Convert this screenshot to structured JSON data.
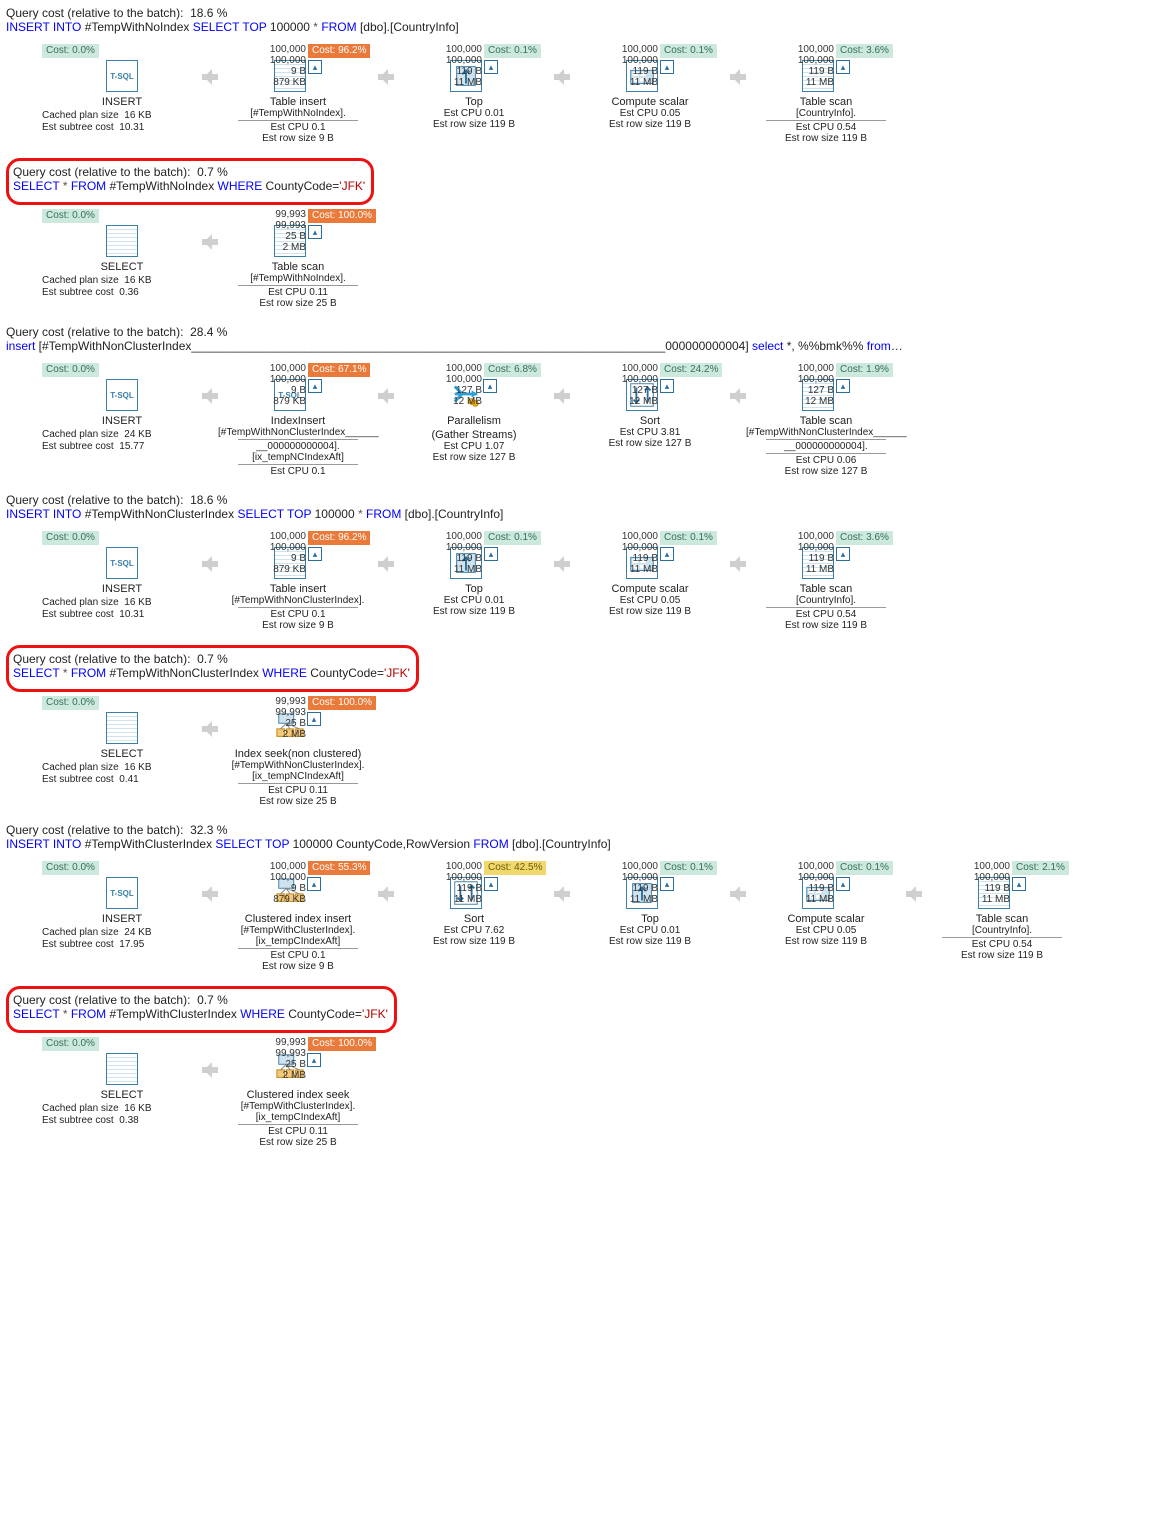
{
  "labels": {
    "query_cost_prefix": "Query cost (relative to the batch):",
    "cached_plan": "Cached plan size",
    "est_subtree": "Est subtree cost",
    "est_cpu": "Est CPU",
    "est_row_size": "Est row size"
  },
  "icons": [
    "tsql",
    "table-insert",
    "top",
    "compute-scalar",
    "table-scan",
    "select",
    "parallelism",
    "sort",
    "index-insert",
    "index-seek",
    "clustered-index-insert",
    "clustered-index-seek"
  ],
  "sections": [
    {
      "id": "q1",
      "highlight": false,
      "cost_pct": "18.6 %",
      "sql": [
        [
          "kw",
          "INSERT INTO"
        ],
        [
          "",
          " #TempWithNoIndex "
        ],
        [
          "kw",
          "SELECT TOP"
        ],
        [
          "",
          " 100000 "
        ],
        [
          "star",
          "*"
        ],
        [
          "",
          " "
        ],
        [
          "kw",
          "FROM"
        ],
        [
          "",
          " [dbo].[CountryInfo]"
        ]
      ],
      "root_metrics": {
        "cached_plan": "16 KB",
        "est_subtree": "10.31"
      },
      "nodes": [
        {
          "cost_left": "Cost: 0.0%",
          "icon": "tsql",
          "label": "INSERT"
        },
        {
          "stats": [
            "100,000",
            "100,000",
            "9 B",
            "879 KB"
          ],
          "cost_right": "Cost: 96.2%",
          "cost_class": "co",
          "icon": "table-insert",
          "label": "Table insert",
          "sub": [
            "[#TempWithNoIndex].",
            "—",
            "Est CPU  0.1",
            "Est row size  9 B"
          ]
        },
        {
          "stats": [
            "100,000",
            "100,000",
            "119 B",
            "11 MB"
          ],
          "cost_right": "Cost: 0.1%",
          "cost_class": "cg",
          "icon": "top",
          "label": "Top",
          "sub": [
            "Est CPU  0.01",
            "Est row size  119 B"
          ]
        },
        {
          "stats": [
            "100,000",
            "100,000",
            "119 B",
            "11 MB"
          ],
          "cost_right": "Cost: 0.1%",
          "cost_class": "cg",
          "icon": "compute",
          "label": "Compute scalar",
          "sub": [
            "Est CPU  0.05",
            "Est row size  119 B"
          ]
        },
        {
          "stats": [
            "100,000",
            "100,000",
            "119 B",
            "11 MB"
          ],
          "cost_right": "Cost: 3.6%",
          "cost_class": "cg",
          "icon": "table-scan",
          "label": "Table scan",
          "sub": [
            "[CountryInfo].",
            "—",
            "Est CPU  0.54",
            "Est row size  119 B"
          ]
        }
      ]
    },
    {
      "id": "q2",
      "highlight": true,
      "cost_pct": "0.7 %",
      "sql": [
        [
          "kw",
          "SELECT"
        ],
        [
          "",
          " "
        ],
        [
          "star",
          "*"
        ],
        [
          "",
          " "
        ],
        [
          "kw",
          "FROM"
        ],
        [
          "",
          " #TempWithNoIndex "
        ],
        [
          "kw",
          "WHERE"
        ],
        [
          "",
          " CountyCode="
        ],
        [
          "lit",
          "'JFK'"
        ]
      ],
      "root_metrics": {
        "cached_plan": "16 KB",
        "est_subtree": "0.36"
      },
      "nodes": [
        {
          "cost_left": "Cost: 0.0%",
          "icon": "select",
          "label": "SELECT"
        },
        {
          "stats": [
            "99,993",
            "99,993",
            "25 B",
            "2 MB"
          ],
          "cost_right": "Cost: 100.0%",
          "cost_class": "co",
          "icon": "table-scan",
          "label": "Table scan",
          "sub": [
            "[#TempWithNoIndex].",
            "—",
            "Est CPU  0.11",
            "Est row size  25 B"
          ]
        }
      ]
    },
    {
      "id": "q3",
      "highlight": false,
      "cost_pct": "28.4 %",
      "sql": [
        [
          "kw",
          "insert"
        ],
        [
          "",
          " [#TempWithNonClusterIndex_______________________________________________________________________000000000004] "
        ],
        [
          "kw",
          "select"
        ],
        [
          "",
          " *, %%bmk%% "
        ],
        [
          "kw",
          "from"
        ],
        [
          "",
          "…"
        ]
      ],
      "root_metrics": {
        "cached_plan": "24 KB",
        "est_subtree": "15.77"
      },
      "nodes": [
        {
          "cost_left": "Cost: 0.0%",
          "icon": "tsql",
          "label": "INSERT"
        },
        {
          "stats": [
            "100,000",
            "100,000",
            "9 B",
            "879 KB"
          ],
          "cost_right": "Cost: 67.1%",
          "cost_class": "co",
          "icon": "tsql",
          "label": "IndexInsert",
          "sub": [
            "[#TempWithNonClusterIndex______",
            "—",
            "__000000000004].",
            "[ix_tempNCIndexAft]",
            "—",
            "Est CPU  0.1"
          ]
        },
        {
          "stats": [
            "100,000",
            "100,000",
            "127 B",
            "12 MB"
          ],
          "cost_right": "Cost: 6.8%",
          "cost_class": "cg",
          "icon": "parallel",
          "label": "Parallelism",
          "label2": "(Gather Streams)",
          "sub": [
            "Est CPU  1.07",
            "Est row size  127 B"
          ]
        },
        {
          "stats": [
            "100,000",
            "100,000",
            "127 B",
            "12 MB"
          ],
          "cost_right": "Cost: 24.2%",
          "cost_class": "cg",
          "icon": "sort",
          "label": "Sort",
          "sub": [
            "Est CPU  3.81",
            "Est row size  127 B"
          ]
        },
        {
          "stats": [
            "100,000",
            "100,000",
            "127 B",
            "12 MB"
          ],
          "cost_right": "Cost: 1.9%",
          "cost_class": "cg",
          "icon": "table-scan",
          "label": "Table scan",
          "sub": [
            "[#TempWithNonClusterIndex______",
            "—",
            "__000000000004].",
            "—",
            "Est CPU  0.06",
            "Est row size  127 B"
          ]
        }
      ]
    },
    {
      "id": "q4",
      "highlight": false,
      "cost_pct": "18.6 %",
      "sql": [
        [
          "kw",
          "INSERT INTO"
        ],
        [
          "",
          " #TempWithNonClusterIndex "
        ],
        [
          "kw",
          "SELECT TOP"
        ],
        [
          "",
          " 100000 "
        ],
        [
          "star",
          "*"
        ],
        [
          "",
          " "
        ],
        [
          "kw",
          "FROM"
        ],
        [
          "",
          " [dbo].[CountryInfo]"
        ]
      ],
      "root_metrics": {
        "cached_plan": "16 KB",
        "est_subtree": "10.31"
      },
      "nodes": [
        {
          "cost_left": "Cost: 0.0%",
          "icon": "tsql",
          "label": "INSERT"
        },
        {
          "stats": [
            "100,000",
            "100,000",
            "9 B",
            "879 KB"
          ],
          "cost_right": "Cost: 96.2%",
          "cost_class": "co",
          "icon": "table-insert",
          "label": "Table insert",
          "sub": [
            "[#TempWithNonClusterIndex].",
            "—",
            "Est CPU  0.1",
            "Est row size  9 B"
          ]
        },
        {
          "stats": [
            "100,000",
            "100,000",
            "119 B",
            "11 MB"
          ],
          "cost_right": "Cost: 0.1%",
          "cost_class": "cg",
          "icon": "top",
          "label": "Top",
          "sub": [
            "Est CPU  0.01",
            "Est row size  119 B"
          ]
        },
        {
          "stats": [
            "100,000",
            "100,000",
            "119 B",
            "11 MB"
          ],
          "cost_right": "Cost: 0.1%",
          "cost_class": "cg",
          "icon": "compute",
          "label": "Compute scalar",
          "sub": [
            "Est CPU  0.05",
            "Est row size  119 B"
          ]
        },
        {
          "stats": [
            "100,000",
            "100,000",
            "119 B",
            "11 MB"
          ],
          "cost_right": "Cost: 3.6%",
          "cost_class": "cg",
          "icon": "table-scan",
          "label": "Table scan",
          "sub": [
            "[CountryInfo].",
            "—",
            "Est CPU  0.54",
            "Est row size  119 B"
          ]
        }
      ]
    },
    {
      "id": "q5",
      "highlight": true,
      "cost_pct": "0.7 %",
      "sql": [
        [
          "kw",
          "SELECT"
        ],
        [
          "",
          " "
        ],
        [
          "star",
          "*"
        ],
        [
          "",
          " "
        ],
        [
          "kw",
          "FROM"
        ],
        [
          "",
          " #TempWithNonClusterIndex "
        ],
        [
          "kw",
          "WHERE"
        ],
        [
          "",
          " CountyCode="
        ],
        [
          "lit",
          "'JFK'"
        ]
      ],
      "root_metrics": {
        "cached_plan": "16 KB",
        "est_subtree": "0.41"
      },
      "nodes": [
        {
          "cost_left": "Cost: 0.0%",
          "icon": "select",
          "label": "SELECT"
        },
        {
          "stats": [
            "99,993",
            "99,993",
            "25 B",
            "2 MB"
          ],
          "cost_right": "Cost: 100.0%",
          "cost_class": "co",
          "icon": "index-seek",
          "label": "Index seek(non clustered)",
          "sub": [
            "[#TempWithNonClusterIndex].",
            "[ix_tempNCIndexAft]",
            "—",
            "Est CPU  0.11",
            "Est row size  25 B"
          ]
        }
      ]
    },
    {
      "id": "q6",
      "highlight": false,
      "cost_pct": "32.3 %",
      "sql": [
        [
          "kw",
          "INSERT INTO"
        ],
        [
          "",
          " #TempWithClusterIndex "
        ],
        [
          "kw",
          "SELECT TOP"
        ],
        [
          "",
          " 100000 CountyCode,RowVersion "
        ],
        [
          "kw",
          "FROM"
        ],
        [
          "",
          " [dbo].[CountryInfo]"
        ]
      ],
      "root_metrics": {
        "cached_plan": "24 KB",
        "est_subtree": "17.95"
      },
      "nodes": [
        {
          "cost_left": "Cost: 0.0%",
          "icon": "tsql",
          "label": "INSERT"
        },
        {
          "stats": [
            "100,000",
            "100,000",
            "9 B",
            "879 KB"
          ],
          "cost_right": "Cost: 55.3%",
          "cost_class": "co",
          "icon": "cluster-insert",
          "label": "Clustered index insert",
          "sub": [
            "[#TempWithClusterIndex].",
            "[ix_tempCIndexAft]",
            "—",
            "Est CPU  0.1",
            "Est row size  9 B"
          ]
        },
        {
          "stats": [
            "100,000",
            "100,000",
            "119 B",
            "11 MB"
          ],
          "cost_right": "Cost: 42.5%",
          "cost_class": "cy",
          "icon": "sort",
          "label": "Sort",
          "sub": [
            "Est CPU  7.62",
            "Est row size  119 B"
          ]
        },
        {
          "stats": [
            "100,000",
            "100,000",
            "119 B",
            "11 MB"
          ],
          "cost_right": "Cost: 0.1%",
          "cost_class": "cg",
          "icon": "top",
          "label": "Top",
          "sub": [
            "Est CPU  0.01",
            "Est row size  119 B"
          ]
        },
        {
          "stats": [
            "100,000",
            "100,000",
            "119 B",
            "11 MB"
          ],
          "cost_right": "Cost: 0.1%",
          "cost_class": "cg",
          "icon": "compute",
          "label": "Compute scalar",
          "sub": [
            "Est CPU  0.05",
            "Est row size  119 B"
          ]
        },
        {
          "stats": [
            "100,000",
            "100,000",
            "119 B",
            "11 MB"
          ],
          "cost_right": "Cost: 2.1%",
          "cost_class": "cg",
          "icon": "table-scan",
          "label": "Table scan",
          "sub": [
            "[CountryInfo].",
            "—",
            "Est CPU  0.54",
            "Est row size  119 B"
          ]
        }
      ]
    },
    {
      "id": "q7",
      "highlight": true,
      "cost_pct": "0.7 %",
      "sql": [
        [
          "kw",
          "SELECT"
        ],
        [
          "",
          " "
        ],
        [
          "star",
          "*"
        ],
        [
          "",
          " "
        ],
        [
          "kw",
          "FROM"
        ],
        [
          "",
          " #TempWithClusterIndex "
        ],
        [
          "kw",
          "WHERE"
        ],
        [
          "",
          " CountyCode="
        ],
        [
          "lit",
          "'JFK'"
        ]
      ],
      "root_metrics": {
        "cached_plan": "16 KB",
        "est_subtree": "0.38"
      },
      "nodes": [
        {
          "cost_left": "Cost: 0.0%",
          "icon": "select",
          "label": "SELECT"
        },
        {
          "stats": [
            "99,993",
            "99,993",
            "25 B",
            "2 MB"
          ],
          "cost_right": "Cost: 100.0%",
          "cost_class": "co",
          "icon": "cluster-seek",
          "label": "Clustered index seek",
          "sub": [
            "[#TempWithClusterIndex].",
            "[ix_tempCIndexAft]",
            "—",
            "Est CPU  0.11",
            "Est row size  25 B"
          ]
        }
      ]
    }
  ]
}
